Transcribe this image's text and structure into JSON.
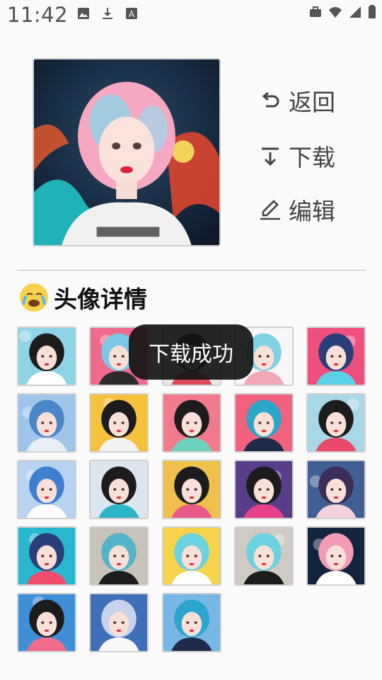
{
  "status_bar": {
    "time": "11:42",
    "left_icons": [
      "image-icon",
      "download-icon",
      "font-icon"
    ],
    "right_icons": [
      "briefcase-icon",
      "wifi-icon",
      "signal-icon",
      "battery-icon"
    ]
  },
  "hero": {
    "image": "avatar-preview-pink-blue-hair"
  },
  "actions": [
    {
      "icon": "undo-icon",
      "label": "返回"
    },
    {
      "icon": "download-icon",
      "label": "下载"
    },
    {
      "icon": "edit-icon",
      "label": "编辑"
    }
  ],
  "section": {
    "emoji": "crying-face-emoji",
    "title": "头像详情"
  },
  "thumbnails": [
    {
      "bg": "#8fd3e6",
      "hair": "#1c1c1c",
      "accent": "#ffffff"
    },
    {
      "bg": "#f06a8e",
      "hair": "#7cc6e6",
      "accent": "#2b2b2b"
    },
    {
      "bg": "#e8e8e8",
      "hair": "#1c1c1c",
      "accent": "#e04a5a"
    },
    {
      "bg": "#f7f7f7",
      "hair": "#7fd1e3",
      "accent": "#f2a7b6"
    },
    {
      "bg": "#ee4f7d",
      "hair": "#2a3f7a",
      "accent": "#5ad0e6"
    },
    {
      "bg": "#9fc5ea",
      "hair": "#4a86c8",
      "accent": "#e8eef6"
    },
    {
      "bg": "#f6c23e",
      "hair": "#1c1c1c",
      "accent": "#f2f2f2"
    },
    {
      "bg": "#f27a8c",
      "hair": "#1c1c1c",
      "accent": "#6dd0bf"
    },
    {
      "bg": "#f2617d",
      "hair": "#2aa6c8",
      "accent": "#1d2b48"
    },
    {
      "bg": "#a8d8e8",
      "hair": "#1c1c1c",
      "accent": "#e94a6a"
    },
    {
      "bg": "#b7d3ef",
      "hair": "#3f7fcf",
      "accent": "#ffffff"
    },
    {
      "bg": "#dde6ee",
      "hair": "#1c1c1c",
      "accent": "#2bb5c6"
    },
    {
      "bg": "#f0c14a",
      "hair": "#1c1c1c",
      "accent": "#e85a8a"
    },
    {
      "bg": "#5a3d8a",
      "hair": "#1c1c1c",
      "accent": "#e6408a"
    },
    {
      "bg": "#3f5f95",
      "hair": "#3b2f5a",
      "accent": "#f2d0dc"
    },
    {
      "bg": "#27b7cf",
      "hair": "#2a3f7a",
      "accent": "#f14d6a"
    },
    {
      "bg": "#c7c2ba",
      "hair": "#53b4c9",
      "accent": "#1c1c1c"
    },
    {
      "bg": "#f6d34a",
      "hair": "#6ad2e0",
      "accent": "#ffffff"
    },
    {
      "bg": "#cfcac3",
      "hair": "#6ad2e0",
      "accent": "#1c1c1c"
    },
    {
      "bg": "#12243e",
      "hair": "#f29cb8",
      "accent": "#ffffff"
    },
    {
      "bg": "#3f8ed8",
      "hair": "#1c1c1c",
      "accent": "#f36b8a"
    },
    {
      "bg": "#3f6fb8",
      "hair": "#c8d2ec",
      "accent": "#f8f8f8"
    },
    {
      "bg": "#78b6e6",
      "hair": "#2aa6d0",
      "accent": "#1d2b48"
    }
  ],
  "toast": {
    "message": "下载成功"
  }
}
